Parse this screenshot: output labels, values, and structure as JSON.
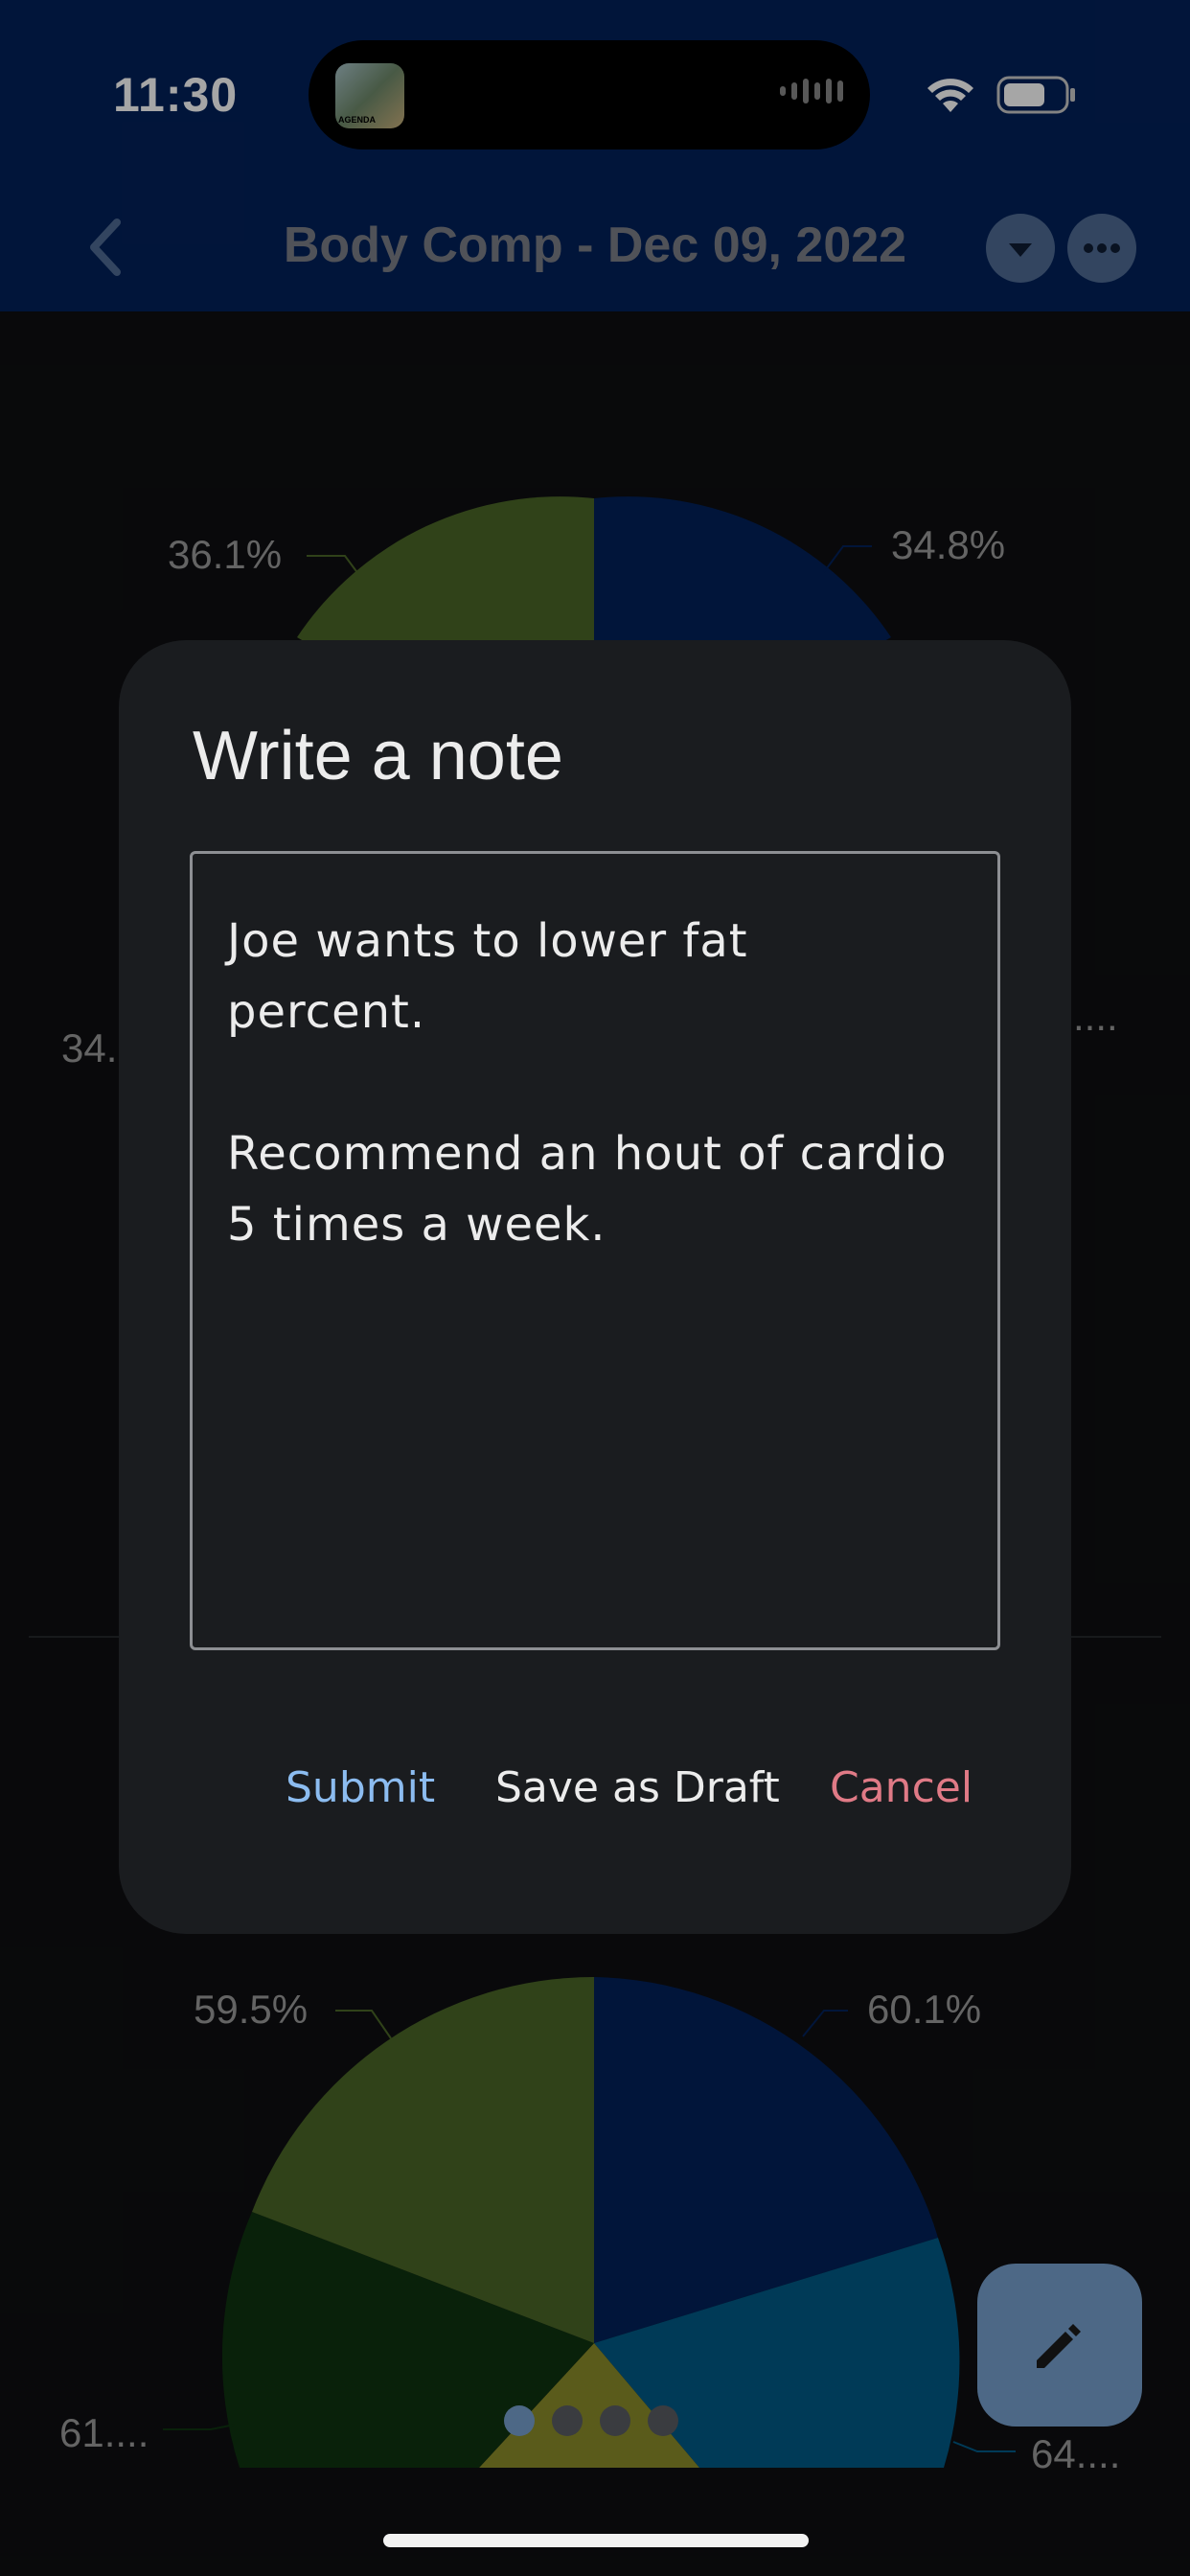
{
  "status_bar": {
    "time": "11:30",
    "island_app_text": "AGENDA",
    "wifi_icon": "wifi-icon",
    "battery_icon": "battery-icon"
  },
  "nav": {
    "title": "Body Comp - Dec 09, 2022",
    "back_icon": "chevron-left-icon",
    "dropdown_icon": "caret-down-icon",
    "more_icon": "ellipsis-icon"
  },
  "background_chart_labels": {
    "top_left": "36.1%",
    "top_right": "34.8%",
    "mid_left": "34.",
    "mid_right": "....",
    "bottom_top_left": "59.5%",
    "bottom_top_right": "60.1%",
    "bottom_left": "61....",
    "bottom_right": "64...."
  },
  "dialog": {
    "title": "Write a note",
    "note_value": "Joe wants to lower fat\npercent.\n\nRecommend an hout of cardio\n5 times a week.",
    "actions": {
      "submit": "Submit",
      "save_draft": "Save as Draft",
      "cancel": "Cancel"
    }
  },
  "pager": {
    "count": 4,
    "active_index": 0
  },
  "fab": {
    "icon": "pencil-icon"
  },
  "colors": {
    "header": "#032159",
    "dialog": "#1a1c1f",
    "submit": "#8cbcf0",
    "cancel": "#e07a86",
    "fab": "#4d6886"
  }
}
